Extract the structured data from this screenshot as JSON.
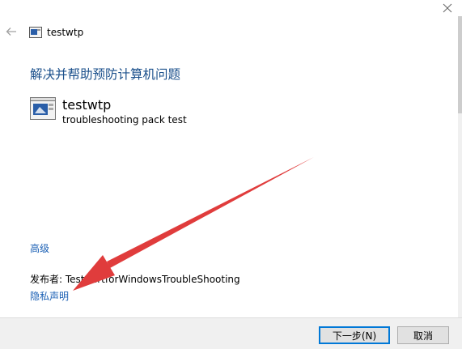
{
  "window": {
    "title": "testwtp",
    "close_icon": "close-icon",
    "back_icon": "back-arrow-icon"
  },
  "main": {
    "heading": "解决并帮助预防计算机问题",
    "pack": {
      "name": "testwtp",
      "description": "troubleshooting pack test",
      "icon": "troubleshooter-icon"
    },
    "advanced_link": "高级",
    "publisher": "发布者:  TestCertforWindowsTroubleShooting",
    "privacy_link": "隐私声明"
  },
  "footer": {
    "next_label": "下一步(N)",
    "cancel_label": "取消"
  },
  "colors": {
    "heading": "#1a4f8b",
    "link": "#1a5fb4",
    "annotation_arrow": "#e03c3c",
    "primary_border": "#0078d7"
  }
}
